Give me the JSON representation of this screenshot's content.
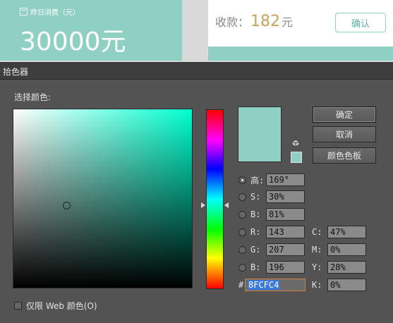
{
  "background": {
    "stat_label": "昨日消费（元）",
    "stat_amount": "30000元",
    "pay_label": "收款：",
    "pay_amount": "182",
    "pay_unit": "元",
    "confirm_label": "确认"
  },
  "dialog": {
    "title": "拾色器",
    "select_color_label": "选择颜色:",
    "current_color": "#8fcfc4",
    "buttons": {
      "ok": "确定",
      "cancel": "取消",
      "swatches": "颜色色板"
    },
    "hsb": [
      {
        "label": "高:",
        "value": "169°",
        "selected": true
      },
      {
        "label": "S:",
        "value": "30%"
      },
      {
        "label": "B:",
        "value": "81%"
      }
    ],
    "rgb": [
      {
        "label": "R:",
        "value": "143"
      },
      {
        "label": "G:",
        "value": "207"
      },
      {
        "label": "B:",
        "value": "196"
      }
    ],
    "cmyk": [
      {
        "label": "C:",
        "value": "47%"
      },
      {
        "label": "M:",
        "value": "0%"
      },
      {
        "label": "Y:",
        "value": "28%"
      },
      {
        "label": "K:",
        "value": "0%"
      }
    ],
    "hex_label": "#",
    "hex_value": "8FCFC4",
    "websafe_label": "仅限 Web 颜色(O)"
  }
}
